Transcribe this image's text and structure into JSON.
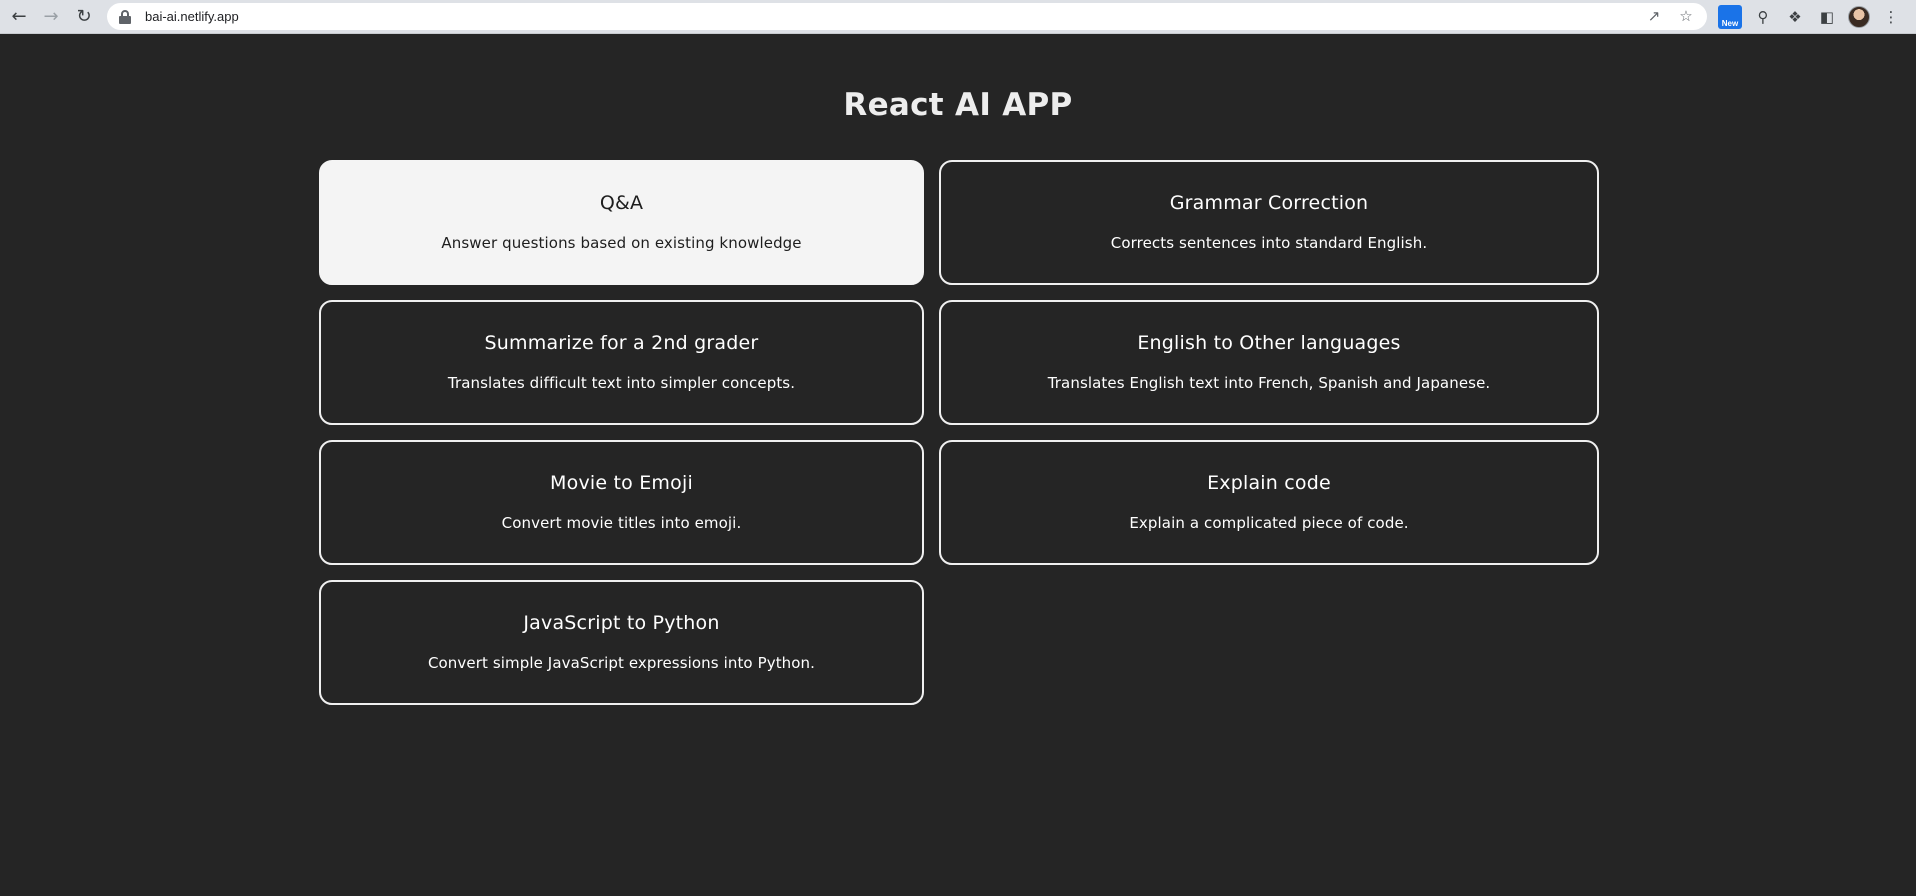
{
  "browser": {
    "url": "bai-ai.netlify.app",
    "extension_badge": "New"
  },
  "app": {
    "title": "React AI APP",
    "cards": [
      {
        "title": "Q&A",
        "description": "Answer questions based on existing knowledge",
        "selected": true
      },
      {
        "title": "Grammar Correction",
        "description": "Corrects sentences into standard English.",
        "selected": false
      },
      {
        "title": "Summarize for a 2nd grader",
        "description": "Translates difficult text into simpler concepts.",
        "selected": false
      },
      {
        "title": "English to Other languages",
        "description": "Translates English text into French, Spanish and Japanese.",
        "selected": false
      },
      {
        "title": "Movie to Emoji",
        "description": "Convert movie titles into emoji.",
        "selected": false
      },
      {
        "title": "Explain code",
        "description": "Explain a complicated piece of code.",
        "selected": false
      },
      {
        "title": "JavaScript to Python",
        "description": "Convert simple JavaScript expressions into Python.",
        "selected": false
      }
    ]
  },
  "colors": {
    "background": "#252525",
    "card_border": "#f0f0f0",
    "card_active_bg": "#f4f4f4"
  }
}
